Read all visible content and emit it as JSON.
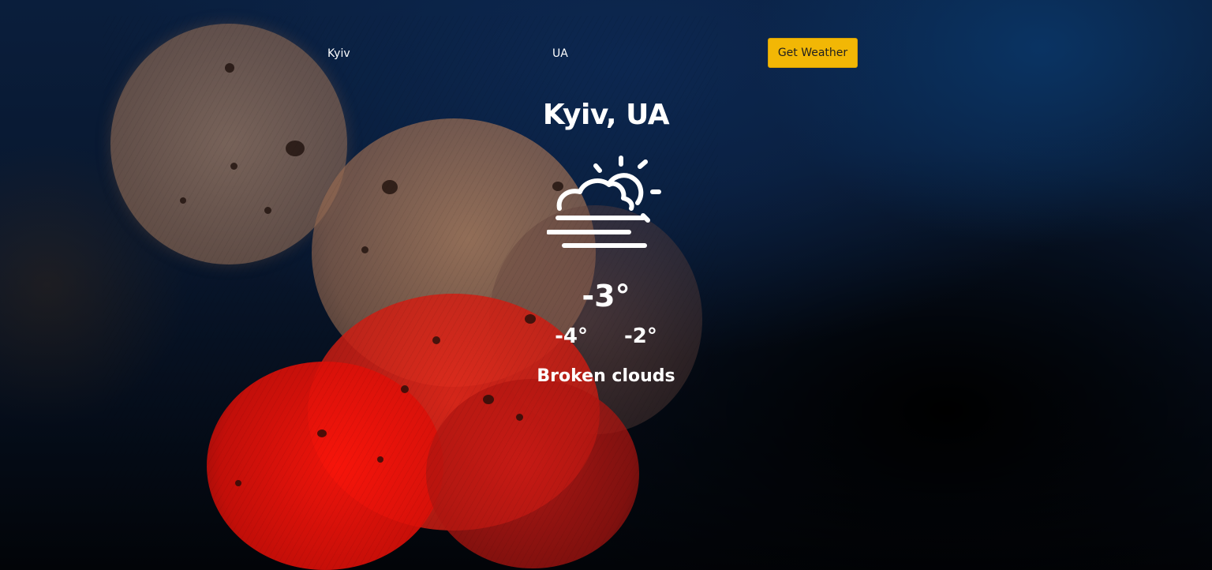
{
  "search": {
    "city_value": "Kyiv",
    "country_value": "UA",
    "button_label": "Get Weather"
  },
  "weather": {
    "location": "Kyiv, UA",
    "icon": "partly-cloudy-fog-icon",
    "temperature": "-3°",
    "min_temperature": "-4°",
    "max_temperature": "-2°",
    "description": "Broken clouds"
  },
  "colors": {
    "button_bg": "#f2b705",
    "text": "#ffffff",
    "background": "#08162c"
  }
}
